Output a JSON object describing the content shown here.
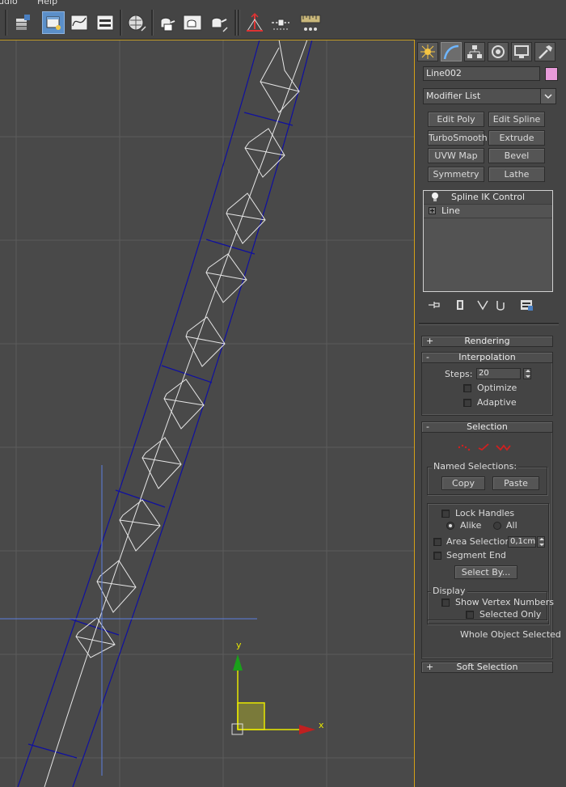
{
  "menu": {
    "items": [
      "udio",
      "Help"
    ]
  },
  "toolbar": {
    "buttons": [
      "layer-explorer",
      "scene-explorer",
      "curve-editor",
      "schematic-view",
      "material-editor",
      "render-setup",
      "rendered-frame",
      "render",
      "align",
      "snapshot",
      "ruler"
    ]
  },
  "command_panel": {
    "tabs": [
      "create",
      "modify",
      "hierarchy",
      "motion",
      "display",
      "utilities"
    ],
    "active_tab": "modify",
    "object_name": "Line002",
    "object_color": "#e89bd9",
    "modifier_list": "Modifier List",
    "modifier_buttons": [
      "Edit Poly",
      "Edit Spline",
      "TurboSmooth",
      "Extrude",
      "UVW Map",
      "Bevel",
      "Symmetry",
      "Lathe"
    ],
    "stack": {
      "modifier": "Spline IK Control",
      "base": "Line"
    }
  },
  "rollouts": {
    "rendering": {
      "title": "Rendering",
      "sign": "+"
    },
    "interpolation": {
      "title": "Interpolation",
      "sign": "-",
      "steps_label": "Steps:",
      "steps_value": "20",
      "optimize": "Optimize",
      "adaptive": "Adaptive"
    },
    "selection": {
      "title": "Selection",
      "sign": "-",
      "named_selections": "Named Selections:",
      "copy": "Copy",
      "paste": "Paste",
      "lock_handles": "Lock Handles",
      "alike": "Alike",
      "all": "All",
      "area_selection": "Area Selection:",
      "area_value": "0,1cm",
      "segment_end": "Segment End",
      "select_by": "Select By...",
      "display": "Display",
      "show_vertex_numbers": "Show Vertex Numbers",
      "selected_only": "Selected Only",
      "status": "Whole Object Selected"
    },
    "soft_selection": {
      "title": "Soft Selection",
      "sign": "+"
    }
  },
  "viewport": {
    "axis_y": "y",
    "axis_x": "x",
    "grid_color": "#5c5c5c",
    "spline_color": "#00008b",
    "line_color": "#e6e6e6"
  }
}
